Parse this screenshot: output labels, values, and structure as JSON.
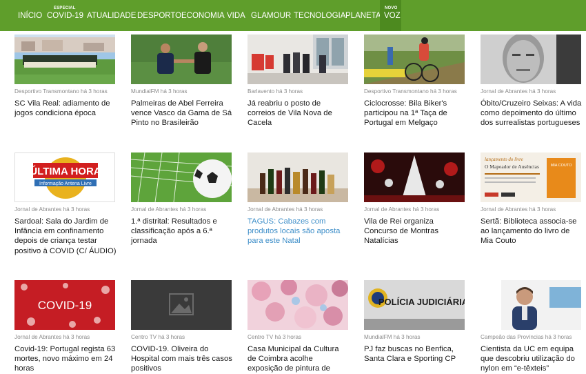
{
  "nav": {
    "items": [
      {
        "label": "INÍCIO"
      },
      {
        "label": "COVID-19",
        "super": "ESPECIAL"
      },
      {
        "label": "ATUALIDADE"
      },
      {
        "label": "DESPORTO"
      },
      {
        "label": "ECONOMIA"
      },
      {
        "label": "VIDA"
      },
      {
        "label": "GLAMOUR"
      },
      {
        "label": "TECNOLOGIA"
      },
      {
        "label": "PLANETA"
      },
      {
        "label": "VOZ",
        "super": "NOVO"
      }
    ]
  },
  "articles": [
    {
      "source": "Desportivo Transmontano",
      "time": "há 3 horas",
      "title": "SC Vila Real: adiamento de jogos condiciona época"
    },
    {
      "source": "MundialFM",
      "time": "há 3 horas",
      "title": "Palmeiras de Abel Ferreira vence Vasco da Gama de Sá Pinto no Brasileirão"
    },
    {
      "source": "Barlavento",
      "time": "há 3 horas",
      "title": "Já reabriu o posto de correios de Vila Nova de Cacela"
    },
    {
      "source": "Desportivo Transmontano",
      "time": "há 3 horas",
      "title": "Ciclocrosse: Bila Biker's participou na 1ª Taça de Portugal em Melgaço"
    },
    {
      "source": "Jornal de Abrantes",
      "time": "há 3 horas",
      "title": "Óbito/Cruzeiro Seixas: A vida como depoimento do último dos surrealistas portugueses"
    },
    {
      "source": "Jornal de Abrantes",
      "time": "há 3 horas",
      "title": "Sardoal: Sala do Jardim de Infância em confinamento depois de criança testar positivo à COVID (C/ ÁUDIO)",
      "thumb_text": [
        "ÚLTIMA HORA",
        "Informação Antena Livre"
      ]
    },
    {
      "source": "Jornal de Abrantes",
      "time": "há 3 horas",
      "title": "1.ª distrital: Resultados e classificação após a 6.ª jornada"
    },
    {
      "source": "Jornal de Abrantes",
      "time": "há 3 horas",
      "title": "TAGUS: Cabazes com produtos locais são aposta para este Natal",
      "link": true
    },
    {
      "source": "Jornal de Abrantes",
      "time": "há 3 horas",
      "title": "Vila de Rei organiza Concurso de Montras Natalícias"
    },
    {
      "source": "Jornal de Abrantes",
      "time": "há 3 horas",
      "title": "Sertã: Biblioteca associa-se ao lançamento do livro de Mia Couto",
      "thumb_text": [
        "lançamento do livre",
        "O Mapeador de Ausências",
        "MIA COUTO"
      ]
    },
    {
      "source": "Jornal de Abrantes",
      "time": "há 3 horas",
      "title": "Covid-19: Portugal regista 63 mortes, novo máximo em 24 horas",
      "thumb_text": [
        "COVID-19"
      ]
    },
    {
      "source": "Centro TV",
      "time": "há 3 horas",
      "title": "COVID-19. Oliveira do Hospital com mais três casos positivos"
    },
    {
      "source": "Centro TV",
      "time": "há 3 horas",
      "title": "Casa Municipal da Cultura de Coimbra acolhe exposição de pintura de"
    },
    {
      "source": "MundialFM",
      "time": "há 3 horas",
      "title": "PJ faz buscas no Benfica, Santa Clara e Sporting CP",
      "thumb_text": [
        "POLÍCIA JUDICIÁRIA"
      ]
    },
    {
      "source": "Campeão das Províncias",
      "time": "há 3 horas",
      "title": "Cientista da UC em equipa que descobriu utilização do nylon em “e-têxteis”"
    }
  ],
  "colors": {
    "nav_bg": "#5f9e2b",
    "nav_active": "#4d8a1f",
    "meta": "#8a8a8a",
    "link": "#3f8fc9"
  }
}
